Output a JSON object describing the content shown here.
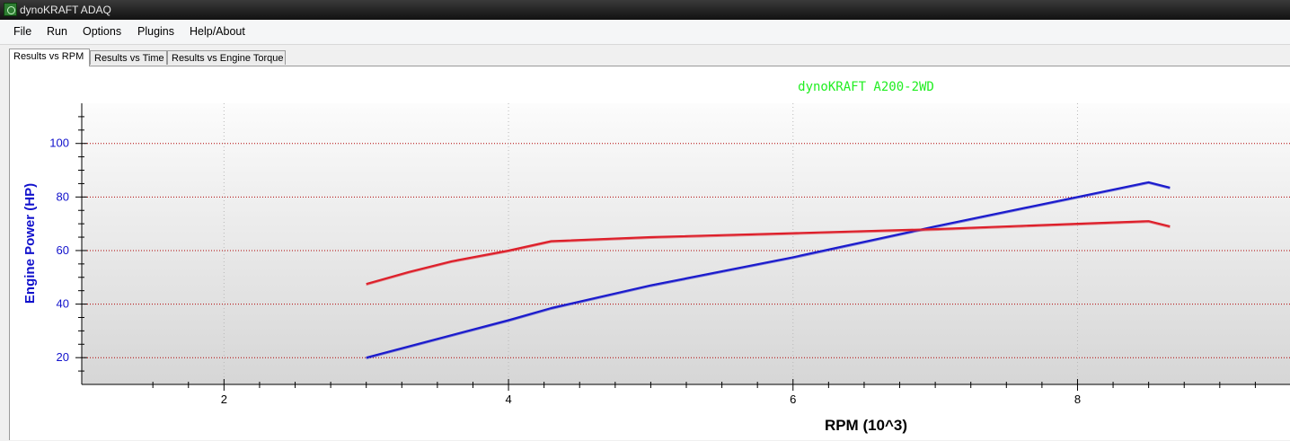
{
  "window": {
    "title": "dynoKRAFT ADAQ"
  },
  "menu": {
    "items": [
      "File",
      "Run",
      "Options",
      "Plugins",
      "Help/About"
    ]
  },
  "tabs": [
    "Results vs RPM",
    "Results vs Time",
    "Results vs Engine Torque"
  ],
  "chart_data": {
    "type": "line",
    "title": "dynoKRAFT A200-2WD",
    "xlabel": "RPM (10^3)",
    "ylabel": "Engine Power (HP)",
    "xlim": [
      1.0,
      9.5
    ],
    "ylim": [
      10,
      115
    ],
    "xticks": [
      2,
      4,
      6,
      8
    ],
    "yticks": [
      20,
      40,
      60,
      80,
      100
    ],
    "grid": true,
    "colors": {
      "title": "#22ee22",
      "axis_label": "#1111cc",
      "series_blue": "#1a1acc",
      "series_red": "#dd1f2a",
      "grid": "#b00000"
    },
    "series": [
      {
        "values_x": [
          3.0,
          3.5,
          4.0,
          4.3,
          5.0,
          6.0,
          7.0,
          8.0,
          8.5,
          8.65
        ],
        "values_y": [
          20,
          27,
          34,
          38.5,
          47,
          57.5,
          69,
          80,
          85.5,
          83.5
        ]
      },
      {
        "values_x": [
          3.0,
          3.3,
          3.6,
          4.0,
          4.3,
          5.0,
          6.0,
          7.0,
          8.0,
          8.5,
          8.65
        ],
        "values_y": [
          47.5,
          52,
          56,
          60,
          63.5,
          65,
          66.5,
          68,
          70,
          71,
          69
        ]
      }
    ]
  }
}
